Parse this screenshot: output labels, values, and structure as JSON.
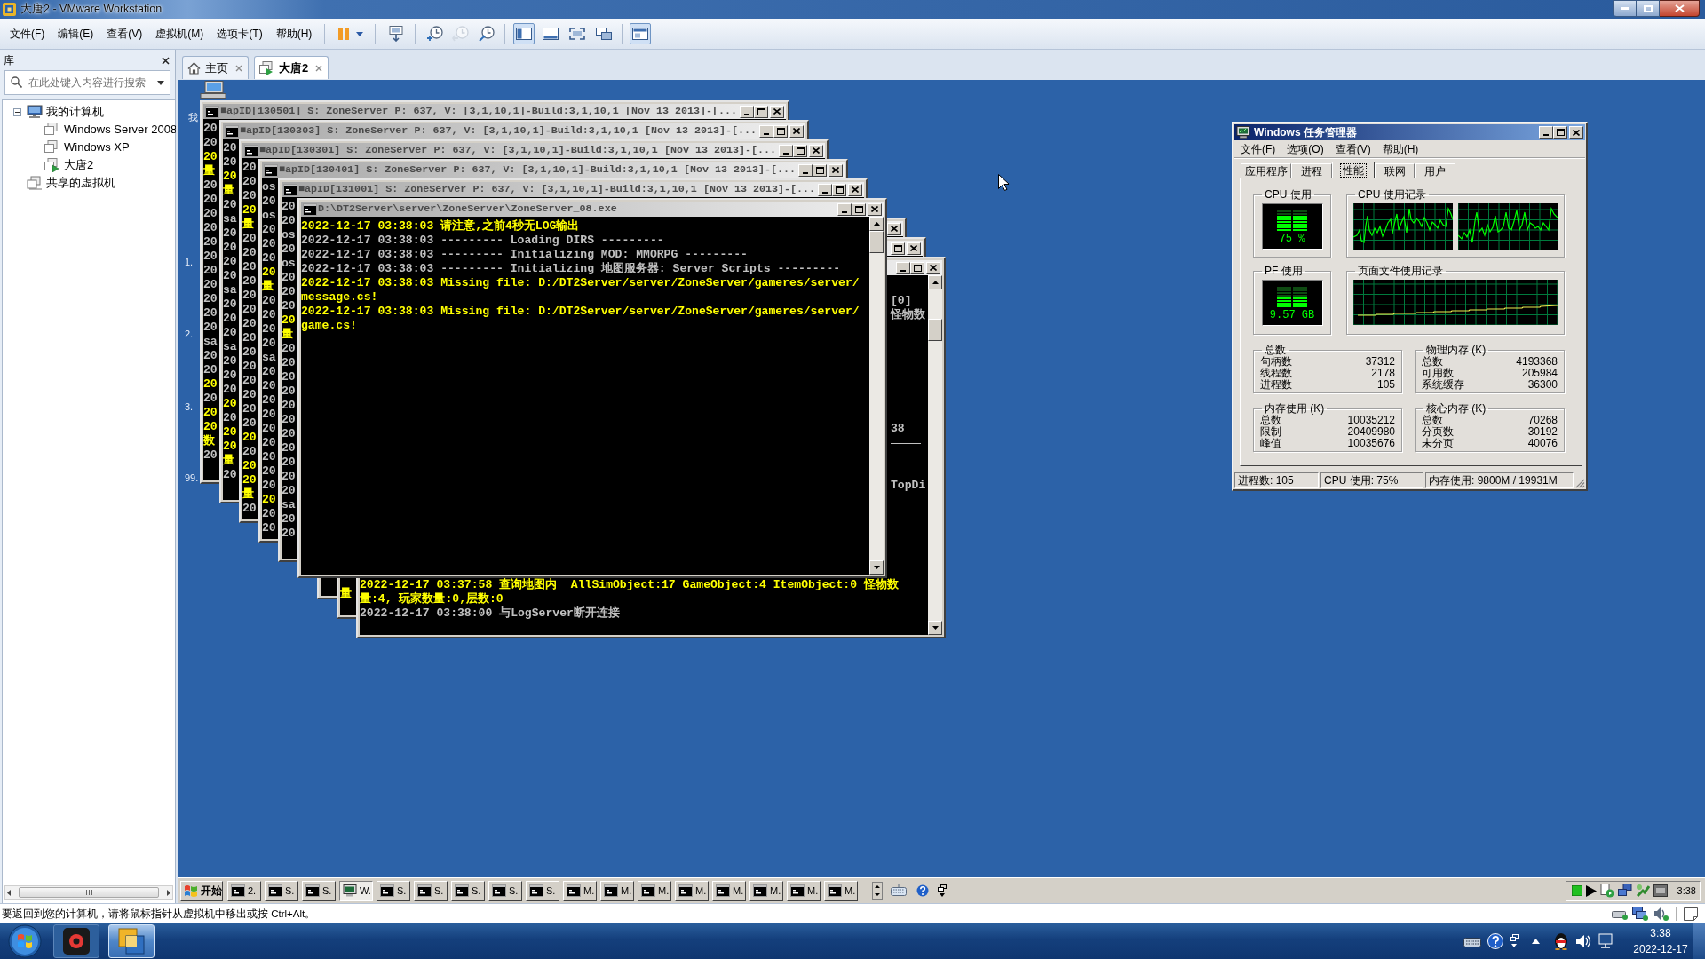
{
  "window": {
    "title": "大唐2 - VMware Workstation"
  },
  "menu": [
    "文件(F)",
    "编辑(E)",
    "查看(V)",
    "虚拟机(M)",
    "选项卡(T)",
    "帮助(H)"
  ],
  "toolbar": {
    "power": [
      {
        "kind": "pause"
      },
      {
        "kind": "caret"
      }
    ],
    "keys": [
      {
        "kind": "send-keys"
      }
    ],
    "snapshots": [
      {
        "kind": "take",
        "disabled": false
      },
      {
        "kind": "revert",
        "disabled": true
      },
      {
        "kind": "manager",
        "disabled": false
      }
    ],
    "views": [
      {
        "kind": "library",
        "selected": true
      },
      {
        "kind": "thumbnails",
        "selected": false
      },
      {
        "kind": "full-screen",
        "selected": false
      },
      {
        "kind": "unity",
        "selected": false
      }
    ],
    "console_view": {
      "selected": true
    }
  },
  "library": {
    "title": "库",
    "search": {
      "placeholder": "在此处键入内容进行搜索"
    },
    "tree": [
      {
        "label": "我的计算机",
        "kind": "computer",
        "expanded": true,
        "children": [
          {
            "label": "Windows Server 2008",
            "kind": "vm",
            "running": false
          },
          {
            "label": "Windows XP",
            "kind": "vm",
            "running": false
          },
          {
            "label": "大唐2",
            "kind": "vm",
            "running": true
          }
        ]
      },
      {
        "label": "共享的虚拟机",
        "kind": "shared"
      }
    ]
  },
  "tabs": [
    {
      "label": "主页",
      "kind": "home",
      "selected": false
    },
    {
      "label": "大唐2",
      "kind": "vm",
      "selected": true
    }
  ],
  "guest": {
    "desktop_labels": [
      "我",
      "1.",
      "2.",
      "3.",
      "99."
    ],
    "consoles_left": [
      {
        "title": "■apID[130501] S: ZoneServer P: 637, V: [3,1,10,1]-Build:3,1,10,1 [Nov 13 2013]-[...",
        "lines": [
          {
            "text": "20",
            "color": "#c0c0c0"
          },
          {
            "text": "20",
            "color": "#c0c0c0"
          },
          {
            "text": "20",
            "color": "#ffff00"
          },
          {
            "text": "量",
            "color": "#ffff00"
          },
          {
            "text": "20",
            "color": "#c0c0c0"
          },
          {
            "text": "20",
            "color": "#c0c0c0"
          },
          {
            "text": "20",
            "color": "#c0c0c0"
          },
          {
            "text": "20",
            "color": "#c0c0c0"
          },
          {
            "text": "20",
            "color": "#c0c0c0"
          },
          {
            "text": "20",
            "color": "#c0c0c0"
          },
          {
            "text": "20",
            "color": "#c0c0c0"
          },
          {
            "text": "20",
            "color": "#c0c0c0"
          },
          {
            "text": "20",
            "color": "#c0c0c0"
          },
          {
            "text": "20",
            "color": "#c0c0c0"
          },
          {
            "text": "20",
            "color": "#c0c0c0"
          },
          {
            "text": "sa",
            "color": "#c0c0c0"
          },
          {
            "text": "20",
            "color": "#c0c0c0"
          },
          {
            "text": "20",
            "color": "#c0c0c0"
          },
          {
            "text": "20",
            "color": "#ffff00"
          },
          {
            "text": "20",
            "color": "#c0c0c0"
          },
          {
            "text": "20",
            "color": "#ffff00"
          },
          {
            "text": "20",
            "color": "#ffff00"
          },
          {
            "text": "数",
            "color": "#ffff00"
          },
          {
            "text": "20",
            "color": "#c0c0c0"
          }
        ]
      },
      {
        "title": "■apID[130303] S: ZoneServer P: 637, V: [3,1,10,1]-Build:3,1,10,1 [Nov 13 2013]-[...",
        "lines": [
          {
            "text": "20",
            "color": "#c0c0c0"
          },
          {
            "text": "20",
            "color": "#c0c0c0"
          },
          {
            "text": "20",
            "color": "#ffff00"
          },
          {
            "text": "量",
            "color": "#ffff00"
          },
          {
            "text": "20",
            "color": "#c0c0c0"
          },
          {
            "text": "sa",
            "color": "#c0c0c0"
          },
          {
            "text": "20",
            "color": "#c0c0c0"
          },
          {
            "text": "20",
            "color": "#c0c0c0"
          },
          {
            "text": "20",
            "color": "#c0c0c0"
          },
          {
            "text": "20",
            "color": "#c0c0c0"
          },
          {
            "text": "sa",
            "color": "#c0c0c0"
          },
          {
            "text": "20",
            "color": "#c0c0c0"
          },
          {
            "text": "20",
            "color": "#c0c0c0"
          },
          {
            "text": "20",
            "color": "#c0c0c0"
          },
          {
            "text": "sa",
            "color": "#c0c0c0"
          },
          {
            "text": "20",
            "color": "#c0c0c0"
          },
          {
            "text": "20",
            "color": "#c0c0c0"
          },
          {
            "text": "20",
            "color": "#c0c0c0"
          },
          {
            "text": "20",
            "color": "#ffff00"
          },
          {
            "text": "20",
            "color": "#c0c0c0"
          },
          {
            "text": "20",
            "color": "#ffff00"
          },
          {
            "text": "20",
            "color": "#ffff00"
          },
          {
            "text": "量",
            "color": "#ffff00"
          },
          {
            "text": "20",
            "color": "#c0c0c0"
          }
        ]
      },
      {
        "title": "■apID[130301] S: ZoneServer P: 637, V: [3,1,10,1]-Build:3,1,10,1 [Nov 13 2013]-[...",
        "lines": [
          {
            "text": "20",
            "color": "#c0c0c0"
          },
          {
            "text": "20",
            "color": "#c0c0c0"
          },
          {
            "text": "20",
            "color": "#c0c0c0"
          },
          {
            "text": "20",
            "color": "#ffff00"
          },
          {
            "text": "量",
            "color": "#ffff00"
          },
          {
            "text": "20",
            "color": "#c0c0c0"
          },
          {
            "text": "20",
            "color": "#c0c0c0"
          },
          {
            "text": "20",
            "color": "#c0c0c0"
          },
          {
            "text": "20",
            "color": "#c0c0c0"
          },
          {
            "text": "20",
            "color": "#c0c0c0"
          },
          {
            "text": "20",
            "color": "#c0c0c0"
          },
          {
            "text": "20",
            "color": "#c0c0c0"
          },
          {
            "text": "20",
            "color": "#c0c0c0"
          },
          {
            "text": "20",
            "color": "#c0c0c0"
          },
          {
            "text": "20",
            "color": "#c0c0c0"
          },
          {
            "text": "20",
            "color": "#c0c0c0"
          },
          {
            "text": "20",
            "color": "#c0c0c0"
          },
          {
            "text": "20",
            "color": "#c0c0c0"
          },
          {
            "text": "20",
            "color": "#c0c0c0"
          },
          {
            "text": "20",
            "color": "#ffff00"
          },
          {
            "text": "20",
            "color": "#c0c0c0"
          },
          {
            "text": "20",
            "color": "#ffff00"
          },
          {
            "text": "20",
            "color": "#ffff00"
          },
          {
            "text": "量",
            "color": "#ffff00"
          },
          {
            "text": "20",
            "color": "#c0c0c0"
          }
        ]
      },
      {
        "title": "■apID[130401] S: ZoneServer P: 637, V: [3,1,10,1]-Build:3,1,10,1 [Nov 13 2013]-[...",
        "lines": [
          {
            "text": "os",
            "color": "#c0c0c0"
          },
          {
            "text": "20",
            "color": "#c0c0c0"
          },
          {
            "text": "os",
            "color": "#c0c0c0"
          },
          {
            "text": "20",
            "color": "#c0c0c0"
          },
          {
            "text": "20",
            "color": "#c0c0c0"
          },
          {
            "text": "20",
            "color": "#c0c0c0"
          },
          {
            "text": "20",
            "color": "#ffff00"
          },
          {
            "text": "量",
            "color": "#ffff00"
          },
          {
            "text": "20",
            "color": "#c0c0c0"
          },
          {
            "text": "20",
            "color": "#c0c0c0"
          },
          {
            "text": "20",
            "color": "#c0c0c0"
          },
          {
            "text": "20",
            "color": "#c0c0c0"
          },
          {
            "text": "sa",
            "color": "#c0c0c0"
          },
          {
            "text": "20",
            "color": "#c0c0c0"
          },
          {
            "text": "20",
            "color": "#c0c0c0"
          },
          {
            "text": "20",
            "color": "#c0c0c0"
          },
          {
            "text": "20",
            "color": "#c0c0c0"
          },
          {
            "text": "20",
            "color": "#c0c0c0"
          },
          {
            "text": "20",
            "color": "#c0c0c0"
          },
          {
            "text": "20",
            "color": "#c0c0c0"
          },
          {
            "text": "20",
            "color": "#c0c0c0"
          },
          {
            "text": "20",
            "color": "#c0c0c0"
          },
          {
            "text": "20",
            "color": "#ffff00"
          },
          {
            "text": "20",
            "color": "#c0c0c0"
          },
          {
            "text": "20",
            "color": "#c0c0c0"
          }
        ]
      },
      {
        "title": "■apID[131001] S: ZoneServer P: 637, V: [3,1,10,1]-Build:3,1,10,1 [Nov 13 2013]-[...",
        "lines": [
          {
            "text": "20",
            "color": "#c0c0c0"
          },
          {
            "text": "20",
            "color": "#c0c0c0"
          },
          {
            "text": "os",
            "color": "#c0c0c0"
          },
          {
            "text": "20",
            "color": "#c0c0c0"
          },
          {
            "text": "os",
            "color": "#c0c0c0"
          },
          {
            "text": "20",
            "color": "#c0c0c0"
          },
          {
            "text": "20",
            "color": "#c0c0c0"
          },
          {
            "text": "20",
            "color": "#c0c0c0"
          },
          {
            "text": "20",
            "color": "#ffff00"
          },
          {
            "text": "量",
            "color": "#ffff00"
          },
          {
            "text": "20",
            "color": "#c0c0c0"
          },
          {
            "text": "20",
            "color": "#c0c0c0"
          },
          {
            "text": "20",
            "color": "#c0c0c0"
          },
          {
            "text": "20",
            "color": "#c0c0c0"
          },
          {
            "text": "20",
            "color": "#c0c0c0"
          },
          {
            "text": "20",
            "color": "#c0c0c0"
          },
          {
            "text": "20",
            "color": "#c0c0c0"
          },
          {
            "text": "20",
            "color": "#c0c0c0"
          },
          {
            "text": "20",
            "color": "#c0c0c0"
          },
          {
            "text": "20",
            "color": "#c0c0c0"
          },
          {
            "text": "20",
            "color": "#c0c0c0"
          },
          {
            "text": "sa",
            "color": "#c0c0c0"
          },
          {
            "text": "20",
            "color": "#c0c0c0"
          },
          {
            "text": "20",
            "color": "#c0c0c0"
          }
        ]
      }
    ],
    "console_front": {
      "title": "D:\\DT2Server\\server\\ZoneServer\\ZoneServer_08.exe",
      "lines": [
        {
          "text": "2022-12-17 03:38:03 请注意,之前4秒无LOG输出",
          "color": "#ffff00"
        },
        {
          "text": "2022-12-17 03:38:03 --------- Loading DIRS ---------",
          "color": "#c0c0c0"
        },
        {
          "text": "2022-12-17 03:38:03 --------- Initializing MOD: MMORPG ---------",
          "color": "#c0c0c0"
        },
        {
          "text": "2022-12-17 03:38:03 --------- Initializing 地图服务器: Server Scripts ---------",
          "color": "#c0c0c0"
        },
        {
          "text": "2022-12-17 03:38:03 Missing file: D:/DT2Server/server/ZoneServer/gameres/server/",
          "color": "#ffff00"
        },
        {
          "text": "message.cs!",
          "color": "#ffff00"
        },
        {
          "text": "2022-12-17 03:38:03 Missing file: D:/DT2Server/server/ZoneServer/gameres/server/",
          "color": "#ffff00"
        },
        {
          "text": "game.cs!",
          "color": "#ffff00"
        }
      ]
    },
    "consoles_right": [
      {
        "buttons": [
          {
            "kind": "close"
          }
        ]
      },
      {
        "buttons": [
          {
            "kind": "maximize"
          },
          {
            "kind": "close"
          }
        ],
        "lines": [
          {
            "text": "量",
            "color": "#ffff00"
          }
        ]
      },
      {
        "buttons": [
          {
            "kind": "minimize"
          },
          {
            "kind": "maximize"
          },
          {
            "kind": "close"
          }
        ],
        "line_ends": [
          "[0]",
          "怪物数",
          "38",
          "TopDi"
        ],
        "lines": [
          {
            "text": "2022-12-17 03:37:58 查询地图内  AllSimObject:17 GameObject:4 ItemObject:0 怪物数",
            "color": "#ffff00"
          },
          {
            "text": "量:4, 玩家数量:0,层数:0",
            "color": "#ffff00"
          },
          {
            "text": "2022-12-17 03:38:00 与LogServer断开连接",
            "color": "#c0c0c0"
          }
        ]
      }
    ],
    "task_manager": {
      "title": "Windows 任务管理器",
      "menu": [
        "文件(F)",
        "选项(O)",
        "查看(V)",
        "帮助(H)"
      ],
      "tabs": [
        {
          "label": "应用程序",
          "selected": false
        },
        {
          "label": "进程",
          "selected": false
        },
        {
          "label": "性能",
          "selected": true
        },
        {
          "label": "联网",
          "selected": false
        },
        {
          "label": "用户",
          "selected": false
        }
      ],
      "cpu_usage": {
        "title": "CPU 使用",
        "reading": "75 %",
        "level": 0.75
      },
      "cpu_history": {
        "title": "CPU 使用记录"
      },
      "pf_usage": {
        "title": "PF 使用",
        "reading": "9.57 GB",
        "level": 0.5
      },
      "pf_history": {
        "title": "页面文件使用记录"
      },
      "groups": [
        {
          "title": "总数",
          "rows": [
            {
              "label": "句柄数",
              "value": "37312"
            },
            {
              "label": "线程数",
              "value": "2178"
            },
            {
              "label": "进程数",
              "value": "105"
            }
          ]
        },
        {
          "title": "物理内存 (K)",
          "rows": [
            {
              "label": "总数",
              "value": "4193368"
            },
            {
              "label": "可用数",
              "value": "205984"
            },
            {
              "label": "系统缓存",
              "value": "36300"
            }
          ]
        },
        {
          "title": "内存使用 (K)",
          "rows": [
            {
              "label": "总数",
              "value": "10035212"
            },
            {
              "label": "限制",
              "value": "20409980"
            },
            {
              "label": "峰值",
              "value": "10035676"
            }
          ]
        },
        {
          "title": "核心内存 (K)",
          "rows": [
            {
              "label": "总数",
              "value": "70268"
            },
            {
              "label": "分页数",
              "value": "30192"
            },
            {
              "label": "未分页",
              "value": "40076"
            }
          ]
        }
      ],
      "status": [
        "进程数: 105",
        "CPU 使用: 75%",
        "内存使用: 9800M / 19931M"
      ]
    },
    "taskbar": {
      "start": "开始",
      "tasks": [
        {
          "label": "2.",
          "kind": "console",
          "selected": false
        },
        {
          "label": "S.",
          "kind": "console",
          "selected": false
        },
        {
          "label": "S.",
          "kind": "console",
          "selected": false
        },
        {
          "label": "W.",
          "kind": "taskmgr",
          "selected": true
        },
        {
          "label": "S.",
          "kind": "console",
          "selected": false
        },
        {
          "label": "S.",
          "kind": "console",
          "selected": false
        },
        {
          "label": "S.",
          "kind": "console",
          "selected": false
        },
        {
          "label": "S.",
          "kind": "console",
          "selected": false
        },
        {
          "label": "S.",
          "kind": "console",
          "selected": false
        },
        {
          "label": "M.",
          "kind": "console",
          "selected": false
        },
        {
          "label": "M.",
          "kind": "console",
          "selected": false
        },
        {
          "label": "M.",
          "kind": "console",
          "selected": false
        },
        {
          "label": "M.",
          "kind": "console",
          "selected": false
        },
        {
          "label": "M.",
          "kind": "console",
          "selected": false
        },
        {
          "label": "M.",
          "kind": "console",
          "selected": false
        },
        {
          "label": "M.",
          "kind": "console",
          "selected": false
        },
        {
          "label": "M.",
          "kind": "console",
          "selected": false
        }
      ],
      "clock": "3:38"
    }
  },
  "status_bar": {
    "text": "要返回到您的计算机，请将鼠标指针从虚拟机中移出或按 Ctrl+Alt。"
  },
  "host_taskbar": {
    "apps": [
      {
        "kind": "recorder",
        "selected": false
      },
      {
        "kind": "vmware",
        "selected": true
      }
    ],
    "time": "3:38",
    "date": "2022-12-17"
  }
}
